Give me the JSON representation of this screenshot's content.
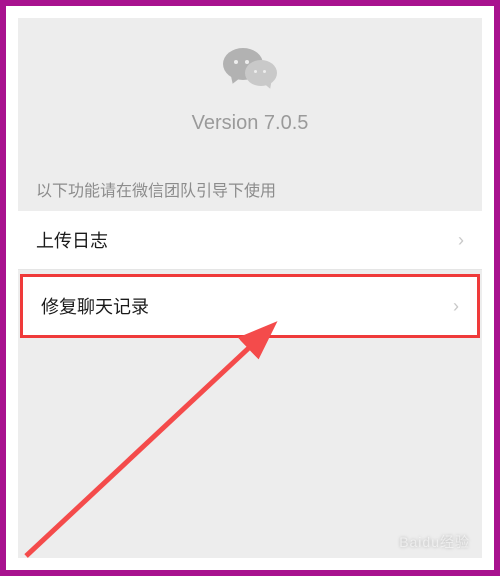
{
  "version_label": "Version 7.0.5",
  "hint_text": "以下功能请在微信团队引导下使用",
  "items": [
    {
      "label": "上传日志"
    },
    {
      "label": "修复聊天记录"
    }
  ],
  "watermark": "Baidu经验",
  "icons": {
    "wechat": "wechat-icon",
    "chevron": "›"
  },
  "colors": {
    "frame": "#a8128f",
    "highlight": "#ef3a3a",
    "arrow": "#f44b4b"
  }
}
